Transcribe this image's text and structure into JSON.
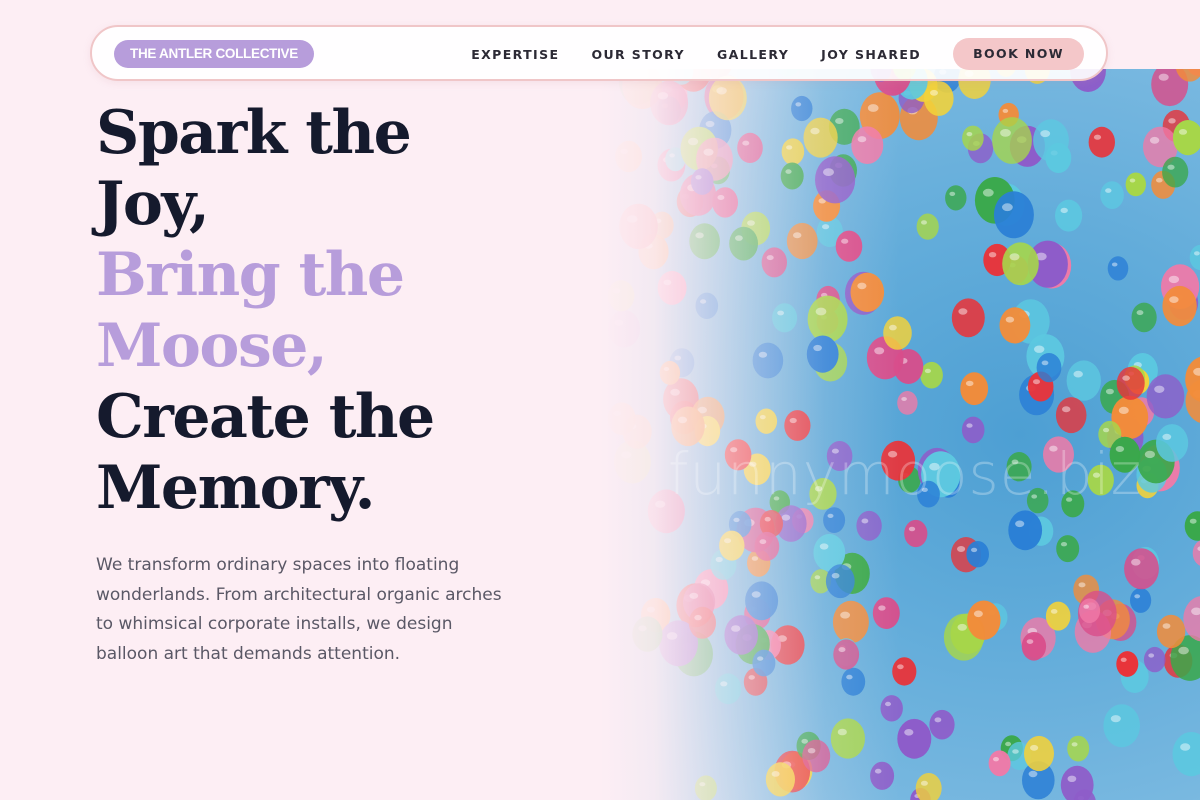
{
  "header": {
    "logo_text": "THE ANTLER COLLECTIVE",
    "nav": [
      "EXPERTISE",
      "OUR STORY",
      "GALLERY",
      "JOY SHARED"
    ],
    "cta": "BOOK NOW"
  },
  "hero": {
    "line1": "Spark the",
    "line2": "Joy,",
    "line3": "Bring the",
    "line4": "Moose,",
    "line5": "Create the",
    "line6": "Memory.",
    "description": "We transform ordinary spaces into floating wonderlands. From architectural organic arches to whimsical corporate installs, we design balloon art that demands attention.",
    "watermark": "funnymoose.biz"
  },
  "colors": {
    "page_bg": "#fdeef4",
    "accent_lavender": "#b79ddb",
    "cta_pink": "#f4c7c9",
    "headline_dark": "#151a2d",
    "sky_blue": "#5aa8d8"
  }
}
